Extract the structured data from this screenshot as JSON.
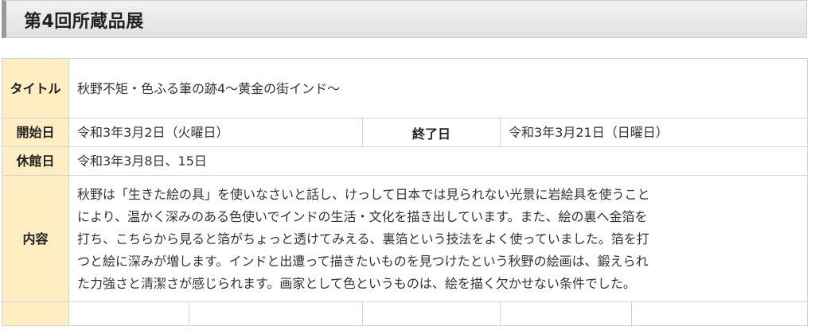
{
  "page": {
    "heading": "第4回所蔵品展"
  },
  "info": {
    "title_label": "タイトル",
    "title_value": "秋野不矩・色ふる筆の跡4〜黄金の街インド〜",
    "start_label": "開始日",
    "start_value": "令和3年3月2日（火曜日）",
    "end_label": "終了日",
    "end_value": "令和3年3月21日（日曜日）",
    "closed_label": "休館日",
    "closed_value": "令和3年3月8日、15日",
    "content_label": "内容",
    "content_lines": [
      "秋野は「生きた絵の具」を使いなさいと話し、けっして日本では見られない光景に岩絵具を使うこと",
      "により、温かく深みのある色使いでインドの生活・文化を描き出しています。また、絵の裏へ金箔を",
      "打ち、こちらから見ると箔がちょっと透けてみえる、裏箔という技法をよく使っていました。箔を打",
      "つと絵に深みが増します。インドと出遭って描きたいものを見つけたという秋野の絵画は、鍛えられ",
      "た力強さと清潔さが感じられます。画家として色というものは、絵を描く欠かせない条件でした。"
    ]
  }
}
